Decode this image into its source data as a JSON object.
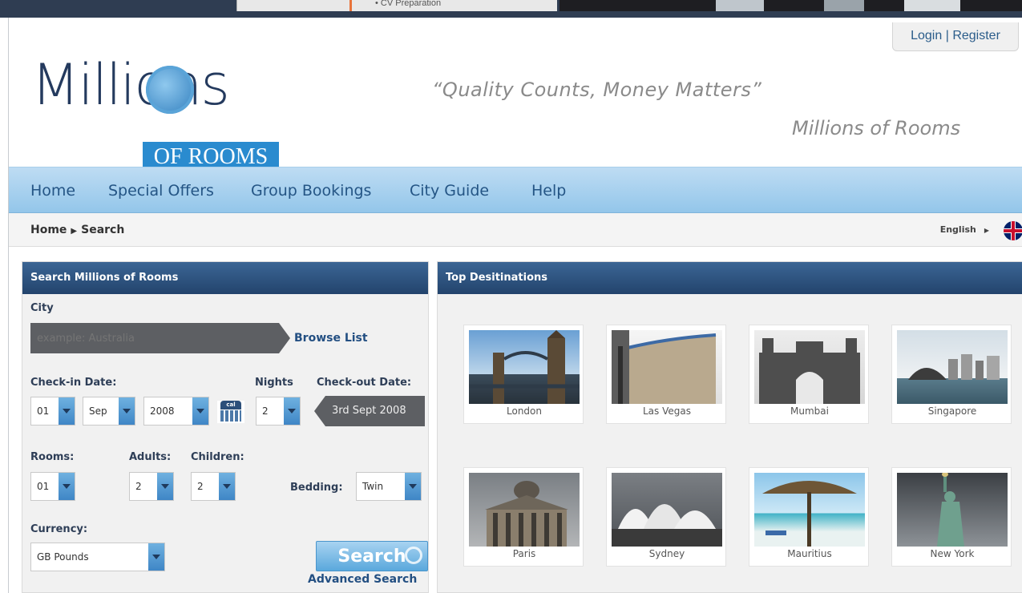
{
  "background_site": {
    "snippet": "• CV Preparation"
  },
  "header": {
    "auth": {
      "login": "Login",
      "separator": " | ",
      "register": "Register"
    },
    "logo": {
      "word": "Millions",
      "badge": "OF ROOMS"
    },
    "tagline": "“Quality Counts, Money Matters”",
    "tagline_sub": "Millions of Rooms"
  },
  "nav": {
    "items": [
      {
        "label": "Home"
      },
      {
        "label": "Special Offers"
      },
      {
        "label": "Group Bookings"
      },
      {
        "label": "City Guide"
      },
      {
        "label": "Help"
      }
    ]
  },
  "breadcrumb": {
    "home": "Home",
    "current": "Search"
  },
  "language": {
    "label": "English"
  },
  "search": {
    "title": "Search Millions of Rooms",
    "city_label": "City",
    "city_placeholder": "example: Australia",
    "browse_list": "Browse List",
    "checkin_label": "Check-in Date:",
    "nights_label": "Nights",
    "checkout_label": "Check-out Date:",
    "checkin_day": "01",
    "checkin_month": "Sep",
    "checkin_year": "2008",
    "calendar_label": "cal",
    "nights": "2",
    "checkout_value": "3rd Sept 2008",
    "rooms_label": "Rooms:",
    "adults_label": "Adults:",
    "children_label": "Children:",
    "rooms": "01",
    "adults": "2",
    "children": "2",
    "bedding_label": "Bedding:",
    "bedding": "Twin",
    "currency_label": "Currency:",
    "currency": "GB Pounds",
    "search_button": "Search",
    "advanced": "Advanced Search"
  },
  "destinations": {
    "title": "Top Desitinations",
    "items": [
      {
        "name": "London"
      },
      {
        "name": "Las Vegas"
      },
      {
        "name": "Mumbai"
      },
      {
        "name": "Singapore"
      },
      {
        "name": "Paris"
      },
      {
        "name": "Sydney"
      },
      {
        "name": "Mauritius"
      },
      {
        "name": "New York"
      }
    ]
  },
  "colors": {
    "navy": "#243a5e",
    "accent": "#2a8bcf",
    "nav_bg": "#a9d2f0",
    "panel_head": "#2c4f7a"
  }
}
